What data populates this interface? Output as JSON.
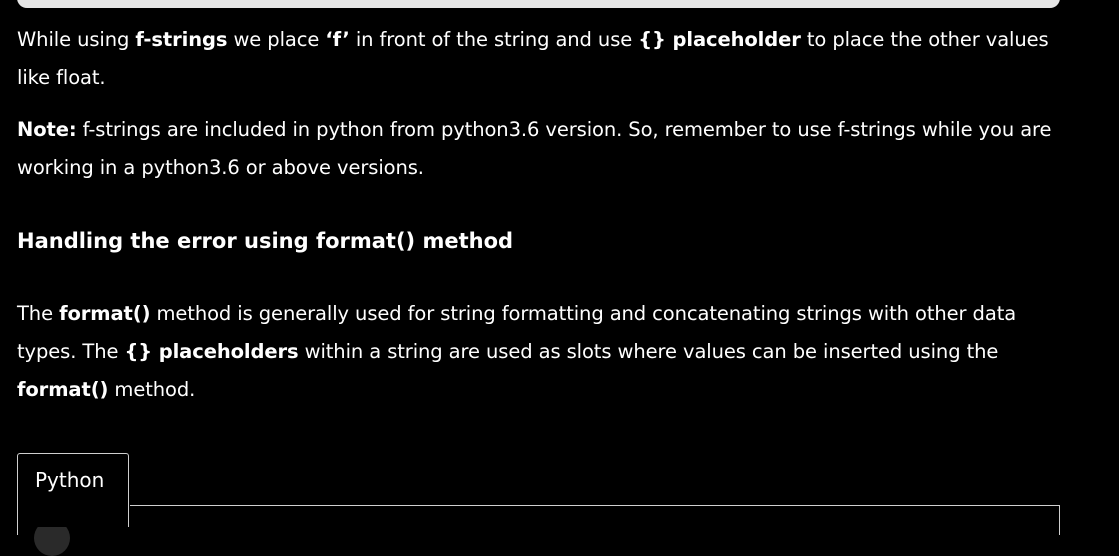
{
  "paragraph1": {
    "t1": "While using ",
    "b1": "f-strings",
    "t2": " we place ",
    "b2": "‘f’",
    "t3": " in front of the string and use ",
    "b3": "{} placeholder",
    "t4": " to place the other values like float."
  },
  "paragraph2": {
    "b1": "Note:",
    "t1": " f-strings are included in python from python3.6 version. So, remember to use f-strings while you are working in a python3.6 or above versions."
  },
  "heading": "Handling the error using format() method",
  "paragraph3": {
    "t1": "The ",
    "b1": "format()",
    "t2": " method is generally used for string formatting and concatenating strings with other data types. The ",
    "b2": "{} placeholders",
    "t3": " within a string are used as slots where values can be inserted using the ",
    "b3": "format()",
    "t4": " method."
  },
  "code_tab": {
    "label": "Python"
  },
  "colors": {
    "background": "#000000",
    "text": "#ffffff",
    "border": "#cfcfcf"
  }
}
